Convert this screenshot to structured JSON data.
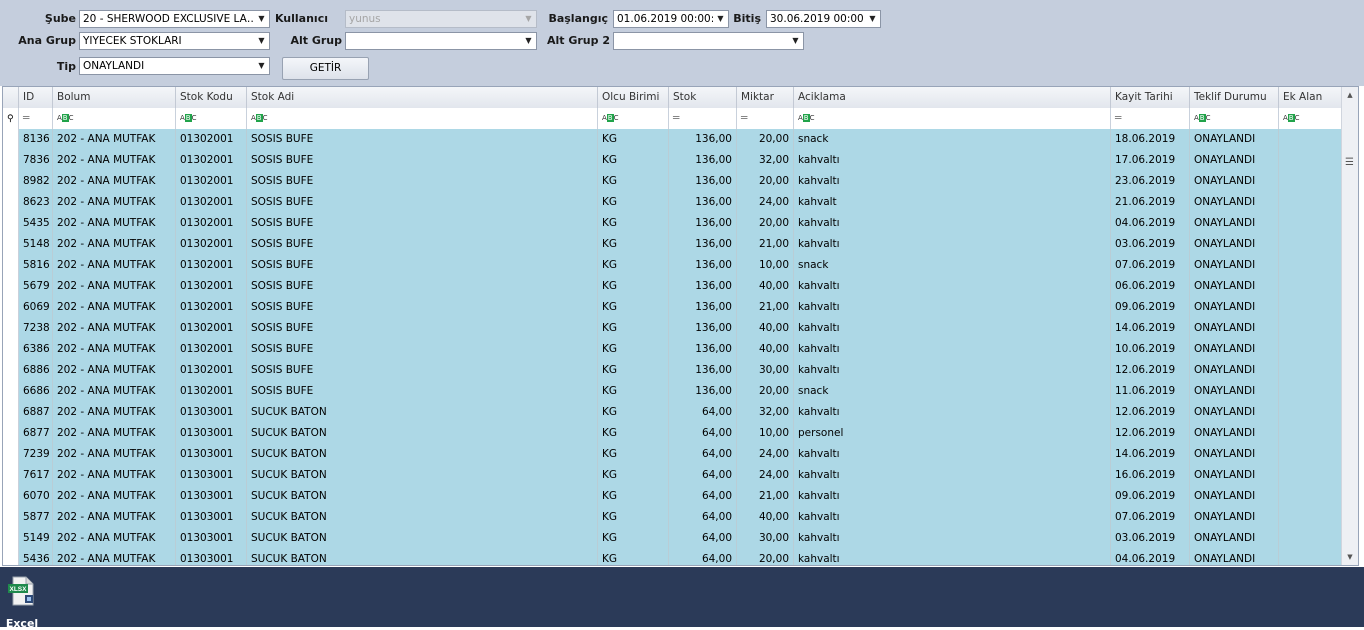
{
  "filters": {
    "sube_label": "Şube",
    "sube_value": "20 - SHERWOOD EXCLUSIVE LA…",
    "kullanici_label": "Kullanıcı",
    "kullanici_value": "yunus",
    "baslangic_label": "Başlangıç",
    "baslangic_value": "01.06.2019 00:00:(",
    "bitis_label": "Bitiş",
    "bitis_value": "30.06.2019 00:00:(",
    "ana_grup_label": "Ana Grup",
    "ana_grup_value": "YIYECEK STOKLARI",
    "alt_grup_label": "Alt Grup",
    "alt_grup_value": "",
    "alt_grup2_label": "Alt Grup 2",
    "alt_grup2_value": "",
    "tip_label": "Tip",
    "tip_value": "ONAYLANDI",
    "getir_label": "GETİR"
  },
  "grid": {
    "columns": [
      "ID",
      "Bolum",
      "Stok Kodu",
      "Stok Adi",
      "Olcu Birimi",
      "Stok",
      "Miktar",
      "Aciklama",
      "Kayit Tarihi",
      "Teklif Durumu",
      "Ek Alan"
    ],
    "rows": [
      [
        "8136",
        "202 - ANA MUTFAK",
        "01302001",
        "SOSIS BUFE",
        "KG",
        "136,00",
        "20,00",
        "snack",
        "18.06.2019",
        "ONAYLANDI",
        ""
      ],
      [
        "7836",
        "202 - ANA MUTFAK",
        "01302001",
        "SOSIS BUFE",
        "KG",
        "136,00",
        "32,00",
        "kahvaltı",
        "17.06.2019",
        "ONAYLANDI",
        ""
      ],
      [
        "8982",
        "202 - ANA MUTFAK",
        "01302001",
        "SOSIS BUFE",
        "KG",
        "136,00",
        "20,00",
        "kahvaltı",
        "23.06.2019",
        "ONAYLANDI",
        ""
      ],
      [
        "8623",
        "202 - ANA MUTFAK",
        "01302001",
        "SOSIS BUFE",
        "KG",
        "136,00",
        "24,00",
        "kahvalt",
        "21.06.2019",
        "ONAYLANDI",
        ""
      ],
      [
        "5435",
        "202 - ANA MUTFAK",
        "01302001",
        "SOSIS BUFE",
        "KG",
        "136,00",
        "20,00",
        "kahvaltı",
        "04.06.2019",
        "ONAYLANDI",
        ""
      ],
      [
        "5148",
        "202 - ANA MUTFAK",
        "01302001",
        "SOSIS BUFE",
        "KG",
        "136,00",
        "21,00",
        "kahvaltı",
        "03.06.2019",
        "ONAYLANDI",
        ""
      ],
      [
        "5816",
        "202 - ANA MUTFAK",
        "01302001",
        "SOSIS BUFE",
        "KG",
        "136,00",
        "10,00",
        "snack",
        "07.06.2019",
        "ONAYLANDI",
        ""
      ],
      [
        "5679",
        "202 - ANA MUTFAK",
        "01302001",
        "SOSIS BUFE",
        "KG",
        "136,00",
        "40,00",
        "kahvaltı",
        "06.06.2019",
        "ONAYLANDI",
        ""
      ],
      [
        "6069",
        "202 - ANA MUTFAK",
        "01302001",
        "SOSIS BUFE",
        "KG",
        "136,00",
        "21,00",
        "kahvaltı",
        "09.06.2019",
        "ONAYLANDI",
        ""
      ],
      [
        "7238",
        "202 - ANA MUTFAK",
        "01302001",
        "SOSIS BUFE",
        "KG",
        "136,00",
        "40,00",
        "kahvaltı",
        "14.06.2019",
        "ONAYLANDI",
        ""
      ],
      [
        "6386",
        "202 - ANA MUTFAK",
        "01302001",
        "SOSIS BUFE",
        "KG",
        "136,00",
        "40,00",
        "kahvaltı",
        "10.06.2019",
        "ONAYLANDI",
        ""
      ],
      [
        "6886",
        "202 - ANA MUTFAK",
        "01302001",
        "SOSIS BUFE",
        "KG",
        "136,00",
        "30,00",
        "kahvaltı",
        "12.06.2019",
        "ONAYLANDI",
        ""
      ],
      [
        "6686",
        "202 - ANA MUTFAK",
        "01302001",
        "SOSIS BUFE",
        "KG",
        "136,00",
        "20,00",
        "snack",
        "11.06.2019",
        "ONAYLANDI",
        ""
      ],
      [
        "6887",
        "202 - ANA MUTFAK",
        "01303001",
        "SUCUK BATON",
        "KG",
        "64,00",
        "32,00",
        "kahvaltı",
        "12.06.2019",
        "ONAYLANDI",
        ""
      ],
      [
        "6877",
        "202 - ANA MUTFAK",
        "01303001",
        "SUCUK BATON",
        "KG",
        "64,00",
        "10,00",
        "personel",
        "12.06.2019",
        "ONAYLANDI",
        ""
      ],
      [
        "7239",
        "202 - ANA MUTFAK",
        "01303001",
        "SUCUK BATON",
        "KG",
        "64,00",
        "24,00",
        "kahvaltı",
        "14.06.2019",
        "ONAYLANDI",
        ""
      ],
      [
        "7617",
        "202 - ANA MUTFAK",
        "01303001",
        "SUCUK BATON",
        "KG",
        "64,00",
        "24,00",
        "kahvaltı",
        "16.06.2019",
        "ONAYLANDI",
        ""
      ],
      [
        "6070",
        "202 - ANA MUTFAK",
        "01303001",
        "SUCUK BATON",
        "KG",
        "64,00",
        "21,00",
        "kahvaltı",
        "09.06.2019",
        "ONAYLANDI",
        ""
      ],
      [
        "5877",
        "202 - ANA MUTFAK",
        "01303001",
        "SUCUK BATON",
        "KG",
        "64,00",
        "40,00",
        "kahvaltı",
        "07.06.2019",
        "ONAYLANDI",
        ""
      ],
      [
        "5149",
        "202 - ANA MUTFAK",
        "01303001",
        "SUCUK BATON",
        "KG",
        "64,00",
        "30,00",
        "kahvaltı",
        "03.06.2019",
        "ONAYLANDI",
        ""
      ],
      [
        "5436",
        "202 - ANA MUTFAK",
        "01303001",
        "SUCUK BATON",
        "KG",
        "64,00",
        "20,00",
        "kahvaltı",
        "04.06.2019",
        "ONAYLANDI",
        ""
      ]
    ]
  },
  "bottombar": {
    "excel_label": "Excel",
    "excel_icon_text": "XLSX"
  },
  "colors": {
    "row_bg": "#add8e6",
    "panel_bg": "#c5cedd",
    "bottom_bg": "#2b3a58"
  }
}
